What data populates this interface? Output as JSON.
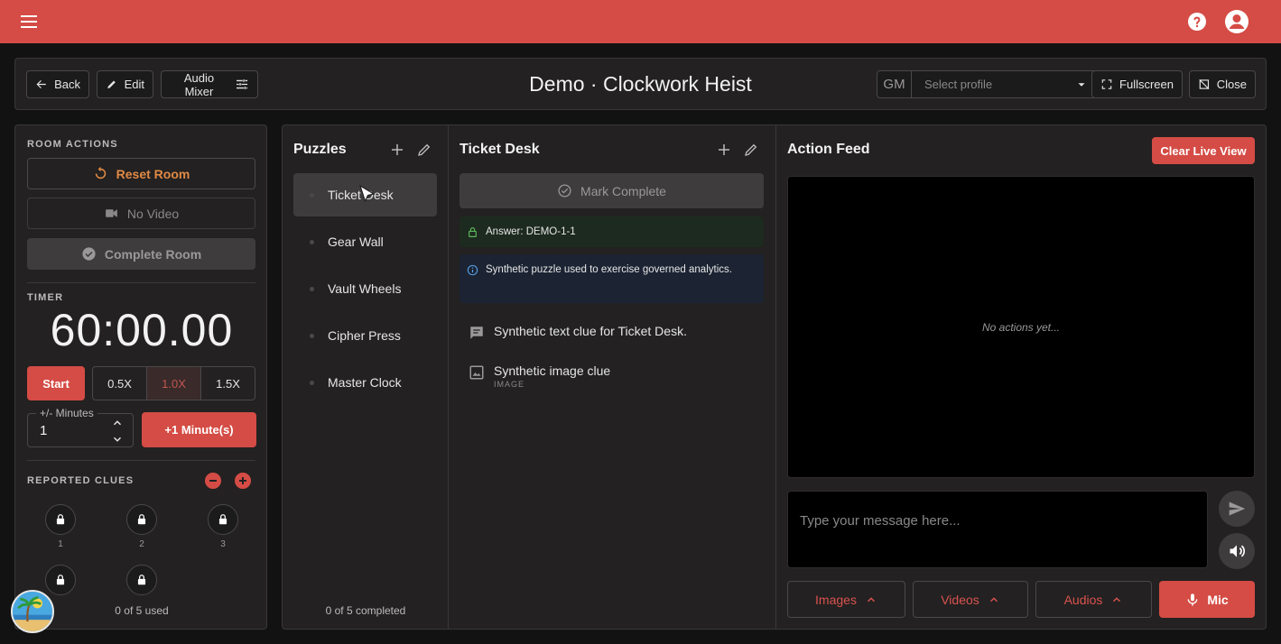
{
  "header": {
    "title": "Demo · Clockwork Heist",
    "back_label": "Back",
    "edit_label": "Edit",
    "audio_mixer_label": "Audio Mixer",
    "profile_prefix": "GM",
    "profile_placeholder": "Select profile",
    "fullscreen_label": "Fullscreen",
    "close_label": "Close"
  },
  "room_actions": {
    "section_label": "ROOM ACTIONS",
    "reset_label": "Reset Room",
    "no_video_label": "No Video",
    "complete_label": "Complete Room"
  },
  "timer": {
    "section_label": "TIMER",
    "display": "60:00.00",
    "start_label": "Start",
    "speeds": [
      "0.5X",
      "1.0X",
      "1.5X"
    ],
    "active_speed": "1.0X",
    "minutes_label": "+/- Minutes",
    "minutes_value": "1",
    "add_minute_label": "+1 Minute(s)"
  },
  "reported_clues": {
    "section_label": "REPORTED CLUES",
    "slots": [
      "1",
      "2",
      "3",
      "",
      ""
    ],
    "used_text": "0 of 5 used"
  },
  "puzzles": {
    "title": "Puzzles",
    "items": [
      "Ticket Desk",
      "Gear Wall",
      "Vault Wheels",
      "Cipher Press",
      "Master Clock"
    ],
    "selected": "Ticket Desk",
    "footer": "0 of 5 completed"
  },
  "detail": {
    "title": "Ticket Desk",
    "mark_complete_label": "Mark Complete",
    "answer": "Answer: DEMO-1-1",
    "info": "Synthetic puzzle used to exercise governed analytics.",
    "clues": [
      {
        "text": "Synthetic text clue for Ticket Desk.",
        "sub": ""
      },
      {
        "text": "Synthetic image clue",
        "sub": "IMAGE"
      }
    ]
  },
  "feed": {
    "title": "Action Feed",
    "clear_label": "Clear Live View",
    "empty_text": "No actions yet...",
    "message_placeholder": "Type your message here...",
    "images_label": "Images",
    "videos_label": "Videos",
    "audios_label": "Audios",
    "mic_label": "Mic"
  },
  "colors": {
    "brand": "#d44c45",
    "panel": "#232121",
    "background": "#121212"
  }
}
